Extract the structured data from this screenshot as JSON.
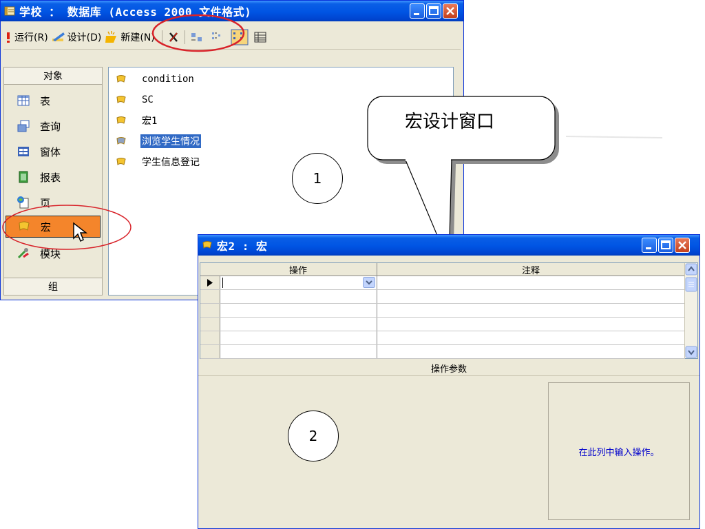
{
  "main_window": {
    "title": "学校 ： 数据库 (Access 2000 文件格式)",
    "toolbar": {
      "run": "运行(R)",
      "design": "设计(D)",
      "new": "新建(N)"
    },
    "objects_header": "对象",
    "objects": [
      {
        "label": "表",
        "icon": "table-icon"
      },
      {
        "label": "查询",
        "icon": "query-icon"
      },
      {
        "label": "窗体",
        "icon": "form-icon"
      },
      {
        "label": "报表",
        "icon": "report-icon"
      },
      {
        "label": "页",
        "icon": "page-icon"
      },
      {
        "label": "宏",
        "icon": "macro-icon",
        "selected": true
      },
      {
        "label": "模块",
        "icon": "module-icon"
      }
    ],
    "groups_label": "组",
    "macros": [
      {
        "label": "condition"
      },
      {
        "label": "SC"
      },
      {
        "label": "宏1"
      },
      {
        "label": "浏览学生情况",
        "selected": true
      },
      {
        "label": "学生信息登记"
      }
    ]
  },
  "macro_window": {
    "title": "宏2 : 宏",
    "col_action": "操作",
    "col_comment": "注释",
    "row_count": 6,
    "params_label": "操作参数",
    "hint": "在此列中输入操作。"
  },
  "callout": {
    "text": "宏设计窗口"
  },
  "markers": {
    "one": "1",
    "two": "2"
  },
  "colors": {
    "title_bar": "#0054e3",
    "selected_object": "#f4852b",
    "selection": "#316ac5",
    "highlight_ellipse": "#d8232a",
    "hint_text": "#0000cc"
  }
}
